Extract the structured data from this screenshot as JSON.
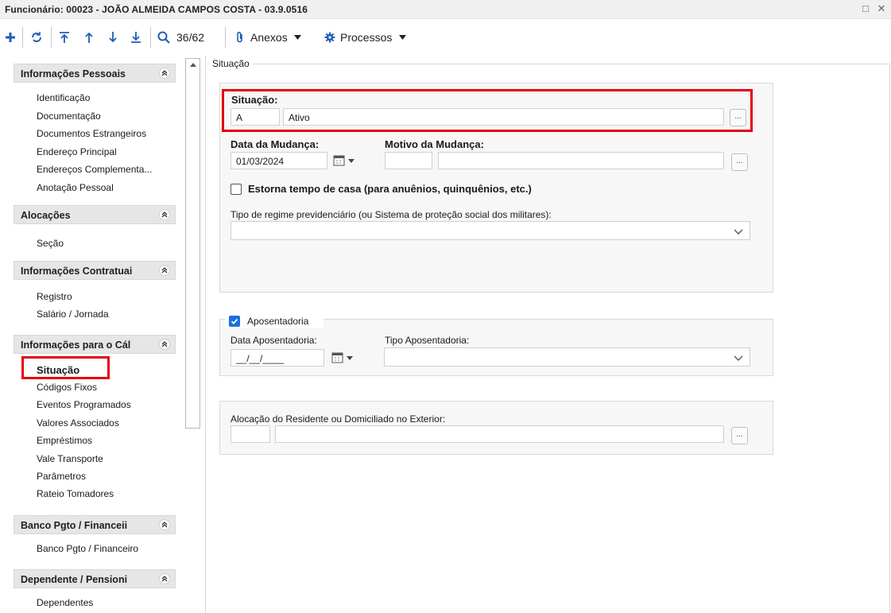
{
  "window": {
    "title": "Funcionário: 00023 - JOÃO ALMEIDA CAMPOS COSTA - 03.9.0516",
    "maximize_glyph": "□",
    "close_glyph": "✕"
  },
  "toolbar": {
    "record_counter": "36/62",
    "attachments_label": "Anexos",
    "processes_label": "Processos",
    "icons": [
      "add-icon",
      "refresh-icon",
      "first-record-icon",
      "previous-record-icon",
      "next-record-icon",
      "last-record-icon",
      "search-icon",
      "paperclip-icon",
      "gear-icon"
    ]
  },
  "sidebar": {
    "groups": [
      {
        "label": "Informações Pessoais",
        "items": [
          "Identificação",
          "Documentação",
          "Documentos Estrangeiros",
          "Endereço Principal",
          "Endereços Complementa...",
          "Anotação Pessoal"
        ]
      },
      {
        "label": "Alocações",
        "items": [
          "Seção"
        ]
      },
      {
        "label": "Informações Contratuai",
        "items": [
          "Registro",
          "Salário / Jornada"
        ]
      },
      {
        "label": "Informações para o Cál",
        "items": [
          "Situação",
          "Códigos Fixos",
          "Eventos Programados",
          "Valores Associados",
          "Empréstimos",
          "Vale Transporte",
          "Parâmetros",
          "Rateio Tomadores"
        ]
      },
      {
        "label": "Banco Pgto / Financeii",
        "items": [
          "Banco Pgto / Financeiro"
        ]
      },
      {
        "label": "Dependente / Pensioni",
        "items": [
          "Dependentes"
        ]
      }
    ],
    "selected_item": "Situação"
  },
  "main": {
    "section_title": "Situação",
    "situacao": {
      "label": "Situação:",
      "code": "A",
      "description": "Ativo",
      "lookup_label": "..."
    },
    "data_mudanca": {
      "label": "Data da Mudança:",
      "value": "01/03/2024"
    },
    "motivo_mudanca": {
      "label": "Motivo da Mudança:",
      "code": "",
      "description": "",
      "lookup_label": "..."
    },
    "estorna": {
      "label": "Estorna tempo de casa (para anuênios, quinquênios, etc.)",
      "checked": false
    },
    "regime": {
      "label": "Tipo de regime previdenciário (ou Sistema de proteção social dos militares):",
      "value": ""
    },
    "aposentadoria": {
      "label": "Aposentadoria",
      "checked": true,
      "data_label": "Data Aposentadoria:",
      "data_value": "__/__/____",
      "tipo_label": "Tipo Aposentadoria:",
      "tipo_value": ""
    },
    "alocacao": {
      "label": "Alocação do Residente ou Domiciliado no Exterior:",
      "code": "",
      "description": "",
      "lookup_label": "..."
    }
  },
  "colors": {
    "highlight": "#e3000f",
    "checkbox_on": "#1e6fd9",
    "toolbar_icon": "#1e5fb4"
  }
}
